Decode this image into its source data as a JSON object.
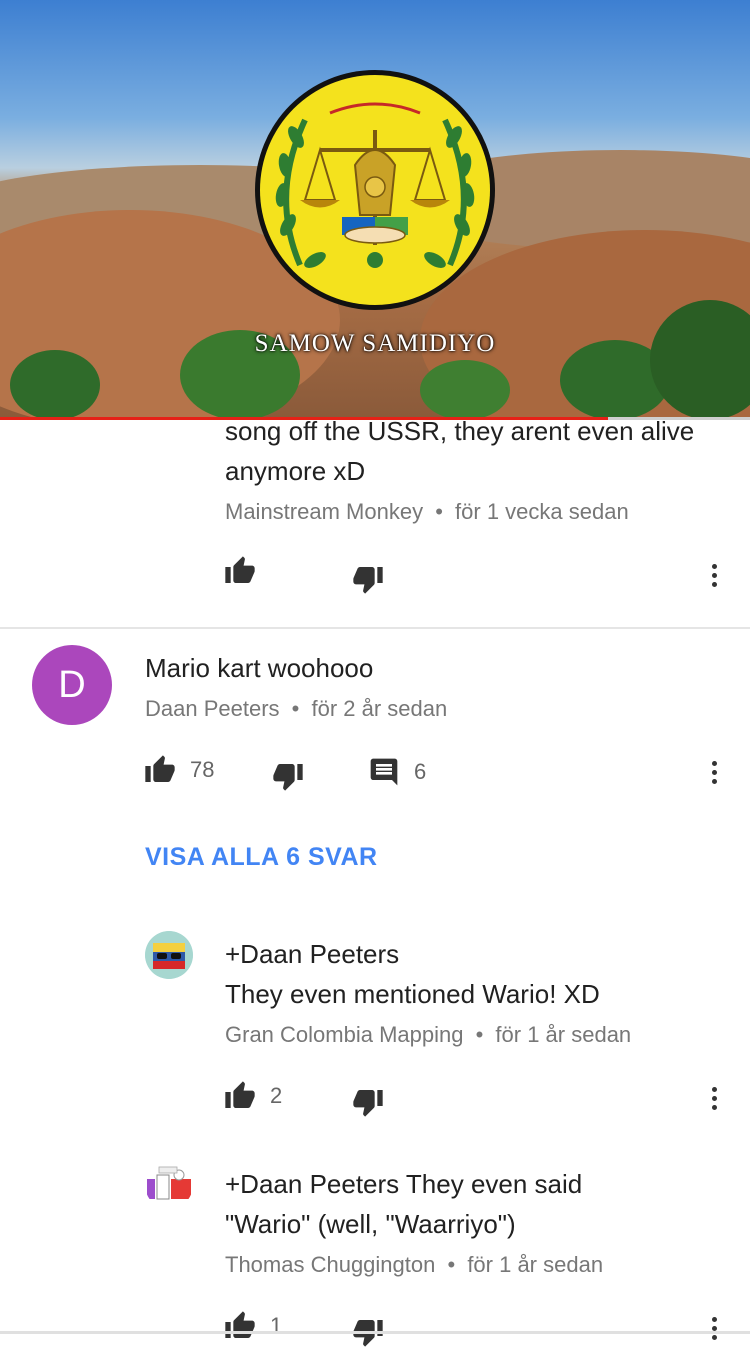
{
  "video": {
    "caption": "SAMOW SAMIDIYO",
    "progress": 0.81,
    "colors": {
      "progress": "#e62117",
      "emblem": "#f4e21d"
    }
  },
  "comments": {
    "first": {
      "text_line1": "song off the USSR, they arent even alive",
      "text_line2": "anymore xD",
      "author": "Mainstream Monkey",
      "time": "för 1 vecka sedan"
    },
    "second": {
      "avatar_letter": "D",
      "text": "Mario kart woohooo",
      "author": "Daan Peeters",
      "time": "för 2 år sedan",
      "likes": "78",
      "replies": "6",
      "show_replies": "VISA ALLA 6 SVAR"
    },
    "reply1": {
      "text_line1": "+Daan Peeters",
      "text_line2": "They even mentioned Wario! XD",
      "author": "Gran Colombia Mapping",
      "time": "för 1 år sedan",
      "likes": "2"
    },
    "reply2": {
      "text_line1": "+Daan Peeters They even said",
      "text_line2": "\"Wario\" (well, \"Waarriyo\")",
      "author": "Thomas Chuggington",
      "time": "för 1 år sedan",
      "likes": "1"
    }
  },
  "separator": "•",
  "icons": [
    "thumb-up-icon",
    "thumb-down-icon",
    "reply-icon",
    "more-vert-icon"
  ],
  "link_color": "#4285f4"
}
